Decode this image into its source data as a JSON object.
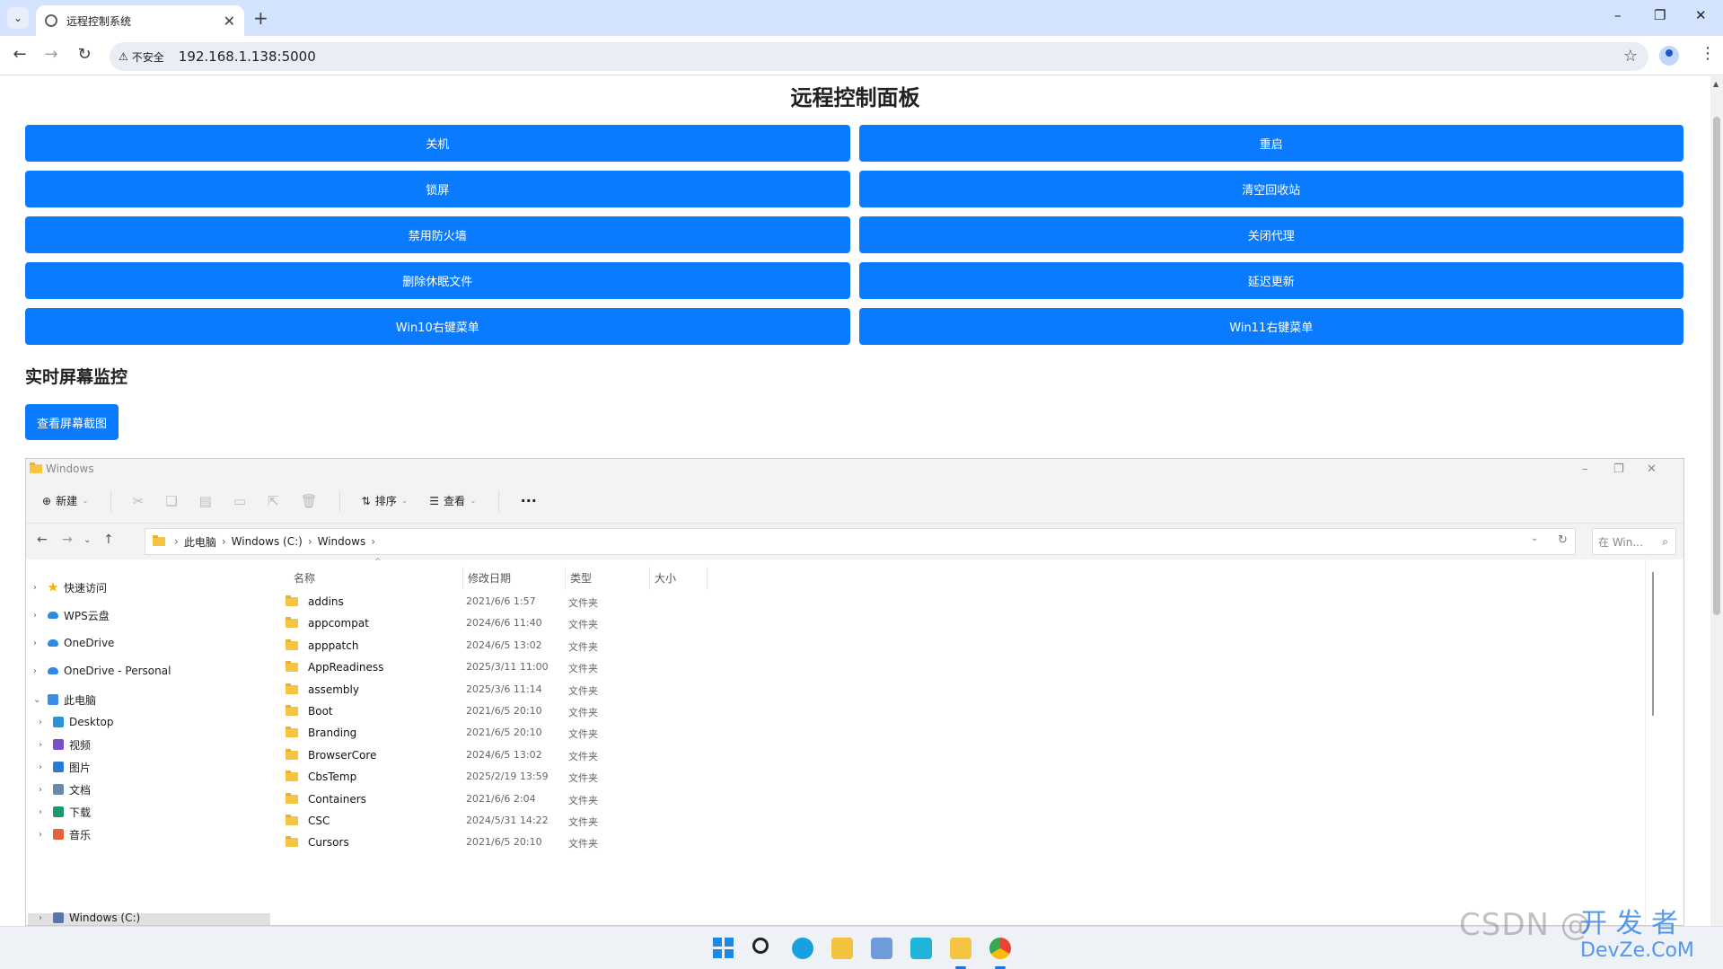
{
  "browser": {
    "tab_title": "远程控制系统",
    "tab_close": "✕",
    "new_tab": "+",
    "win_minimize": "–",
    "win_restore": "❐",
    "win_close": "✕",
    "security_label": "不安全",
    "url": "192.168.1.138:5000"
  },
  "page": {
    "title": "远程控制面板",
    "buttons": [
      "关机",
      "重启",
      "锁屏",
      "清空回收站",
      "禁用防火墙",
      "关闭代理",
      "删除休眠文件",
      "延迟更新",
      "Win10右键菜单",
      "Win11右键菜单"
    ],
    "monitor_heading": "实时屏幕监控",
    "view_screenshot_button": "查看屏幕截图"
  },
  "explorer": {
    "window_title": "Windows",
    "toolbar": {
      "new": "新建",
      "sort": "排序",
      "view": "查看",
      "more": "···"
    },
    "breadcrumb": [
      "此电脑",
      "Windows (C:)",
      "Windows"
    ],
    "search_placeholder": "在 Win...",
    "sidebar": [
      {
        "label": "快速访问",
        "color": "#f5b400"
      },
      {
        "label": "WPS云盘",
        "color": "#2f8ae5"
      },
      {
        "label": "OneDrive",
        "color": "#2f8ae5"
      },
      {
        "label": "OneDrive - Personal",
        "color": "#2f8ae5"
      },
      {
        "label": "此电脑",
        "color": "#3a8ee6"
      },
      {
        "label": "Desktop",
        "color": "#2a93d5"
      },
      {
        "label": "视频",
        "color": "#7a4fc9"
      },
      {
        "label": "图片",
        "color": "#2a7bd5"
      },
      {
        "label": "文档",
        "color": "#6a88a8"
      },
      {
        "label": "下载",
        "color": "#1a9a6a"
      },
      {
        "label": "音乐",
        "color": "#e0633a"
      },
      {
        "label": "Windows (C:)",
        "color": "#5577aa"
      }
    ],
    "columns": [
      "名称",
      "修改日期",
      "类型",
      "大小"
    ],
    "files": [
      {
        "name": "addins",
        "date": "2021/6/6 1:57",
        "type": "文件夹"
      },
      {
        "name": "appcompat",
        "date": "2024/6/6 11:40",
        "type": "文件夹"
      },
      {
        "name": "apppatch",
        "date": "2024/6/5 13:02",
        "type": "文件夹"
      },
      {
        "name": "AppReadiness",
        "date": "2025/3/11 11:00",
        "type": "文件夹"
      },
      {
        "name": "assembly",
        "date": "2025/3/6 11:14",
        "type": "文件夹"
      },
      {
        "name": "Boot",
        "date": "2021/6/5 20:10",
        "type": "文件夹"
      },
      {
        "name": "Branding",
        "date": "2021/6/5 20:10",
        "type": "文件夹"
      },
      {
        "name": "BrowserCore",
        "date": "2024/6/5 13:02",
        "type": "文件夹"
      },
      {
        "name": "CbsTemp",
        "date": "2025/2/19 13:59",
        "type": "文件夹"
      },
      {
        "name": "Containers",
        "date": "2021/6/6 2:04",
        "type": "文件夹"
      },
      {
        "name": "CSC",
        "date": "2024/5/31 14:22",
        "type": "文件夹"
      },
      {
        "name": "Cursors",
        "date": "2021/6/5 20:10",
        "type": "文件夹"
      }
    ]
  },
  "taskbar": {
    "apps": [
      "start-icon",
      "search-icon",
      "edge-icon",
      "lock-app-icon",
      "photos-icon",
      "feishu-icon",
      "file-explorer-icon",
      "chrome-icon"
    ]
  },
  "watermark": {
    "csdn": "CSDN @",
    "devze_top": "开 发 者",
    "devze_bottom": "DevZe.CoM"
  }
}
